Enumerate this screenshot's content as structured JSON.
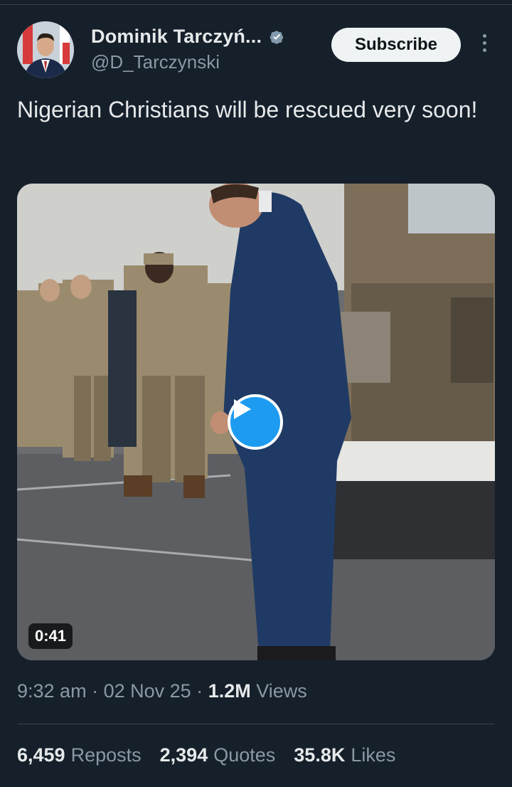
{
  "author": {
    "name": "Dominik Tarczyń...",
    "handle": "@D_Tarczynski",
    "verified": true,
    "avatar_icon": "profile-avatar"
  },
  "actions": {
    "subscribe_label": "Subscribe",
    "more_icon": "more-options-icon"
  },
  "tweet": {
    "text": "Nigerian Christians will be rescued very soon!"
  },
  "media": {
    "type": "video",
    "duration": "0:41",
    "play_icon": "play-icon"
  },
  "meta": {
    "time": "9:32 am",
    "date": "02 Nov 25",
    "views_count": "1.2M",
    "views_label": "Views"
  },
  "stats": {
    "reposts_count": "6,459",
    "reposts_label": "Reposts",
    "quotes_count": "2,394",
    "quotes_label": "Quotes",
    "likes_count": "35.8K",
    "likes_label": "Likes"
  },
  "colors": {
    "background": "#15202b",
    "accent": "#1d9bf0",
    "text_primary": "#e7e9ea",
    "text_secondary": "#8b98a5"
  }
}
